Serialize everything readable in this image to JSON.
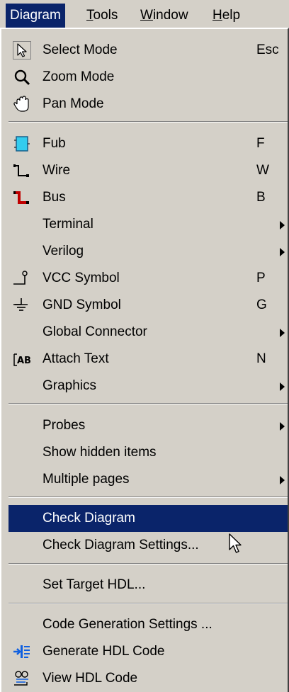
{
  "menubar": {
    "diagram": "Diagram",
    "tools_first": "T",
    "tools_rest": "ools",
    "window_first": "W",
    "window_rest": "indow",
    "help_first": "H",
    "help_rest": "elp"
  },
  "menu": {
    "select_mode": {
      "label": "Select Mode",
      "accel": "Esc"
    },
    "zoom_mode": {
      "label": "Zoom Mode"
    },
    "pan_mode": {
      "label": "Pan Mode"
    },
    "fub": {
      "label": "Fub",
      "accel": "F"
    },
    "wire": {
      "label": "Wire",
      "accel": "W"
    },
    "bus": {
      "label": "Bus",
      "accel": "B"
    },
    "terminal": {
      "label": "Terminal"
    },
    "verilog": {
      "label": "Verilog"
    },
    "vcc_symbol": {
      "label": "VCC Symbol",
      "accel": "P"
    },
    "gnd_symbol": {
      "label": "GND Symbol",
      "accel": "G"
    },
    "global_connector": {
      "label": "Global Connector"
    },
    "attach_text": {
      "label": "Attach Text",
      "accel": "N"
    },
    "graphics": {
      "label": "Graphics"
    },
    "probes": {
      "label": "Probes"
    },
    "show_hidden_items": {
      "label": "Show hidden items"
    },
    "multiple_pages": {
      "label": "Multiple pages"
    },
    "check_diagram": {
      "label": "Check Diagram"
    },
    "check_diagram_settings": {
      "label": "Check Diagram Settings..."
    },
    "set_target_hdl": {
      "label": "Set Target HDL..."
    },
    "code_generation_settings": {
      "label": "Code Generation Settings ..."
    },
    "generate_hdl_code": {
      "label": "Generate HDL Code"
    },
    "view_hdl_code": {
      "label": "View HDL Code"
    }
  },
  "colors": {
    "menu_bg": "#d4d0c8",
    "highlight": "#0a246a",
    "highlight_text": "#ffffff"
  }
}
